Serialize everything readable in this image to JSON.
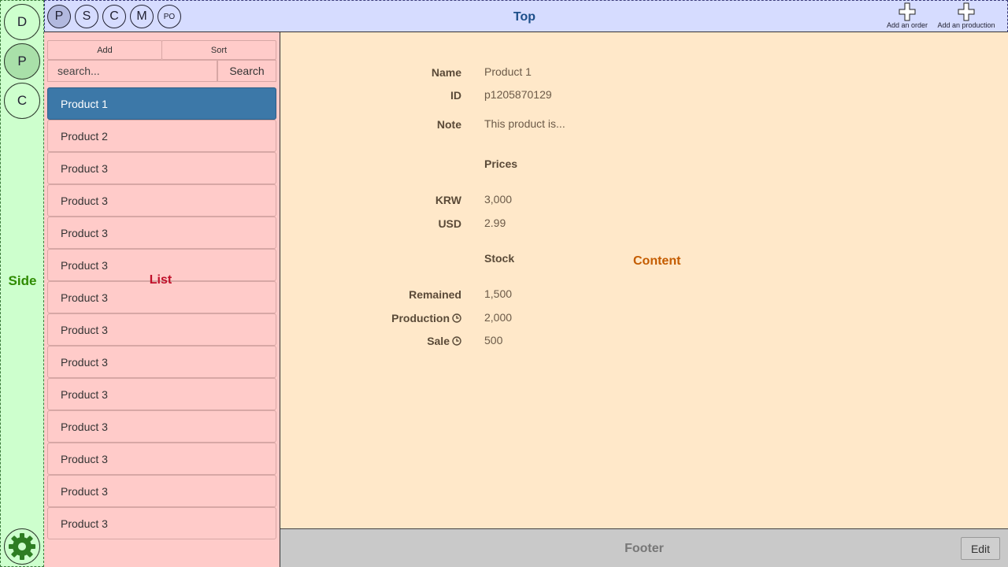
{
  "side": {
    "buttons": [
      "D",
      "P",
      "C"
    ],
    "label": "Side",
    "settings_icon": "gear-icon"
  },
  "top": {
    "label": "Top",
    "buttons": [
      "P",
      "S",
      "C",
      "M",
      "PO"
    ],
    "actions": {
      "add_order": "Add an order",
      "add_production": "Add an production"
    }
  },
  "list": {
    "add_label": "Add",
    "sort_label": "Sort",
    "search_placeholder": "search...",
    "search_label": "Search",
    "label": "List",
    "items": [
      "Product 1",
      "Product 2",
      "Product 3",
      "Product 3",
      "Product 3",
      "Product 3",
      "Product 3",
      "Product 3",
      "Product 3",
      "Product 3",
      "Product 3",
      "Product 3",
      "Product 3",
      "Product 3"
    ],
    "selected_index": 0
  },
  "content": {
    "label": "Content",
    "name_label": "Name",
    "name_value": "Product 1",
    "id_label": "ID",
    "id_value": "p1205870129",
    "note_label": "Note",
    "note_value": "This product is...",
    "prices_heading": "Prices",
    "krw_label": "KRW",
    "krw_value": "3,000",
    "usd_label": "USD",
    "usd_value": "2.99",
    "stock_heading": "Stock",
    "remained_label": "Remained",
    "remained_value": "1,500",
    "production_label": "Production",
    "production_value": "2,000",
    "sale_label": "Sale",
    "sale_value": "500"
  },
  "footer": {
    "label": "Footer",
    "edit_label": "Edit"
  }
}
